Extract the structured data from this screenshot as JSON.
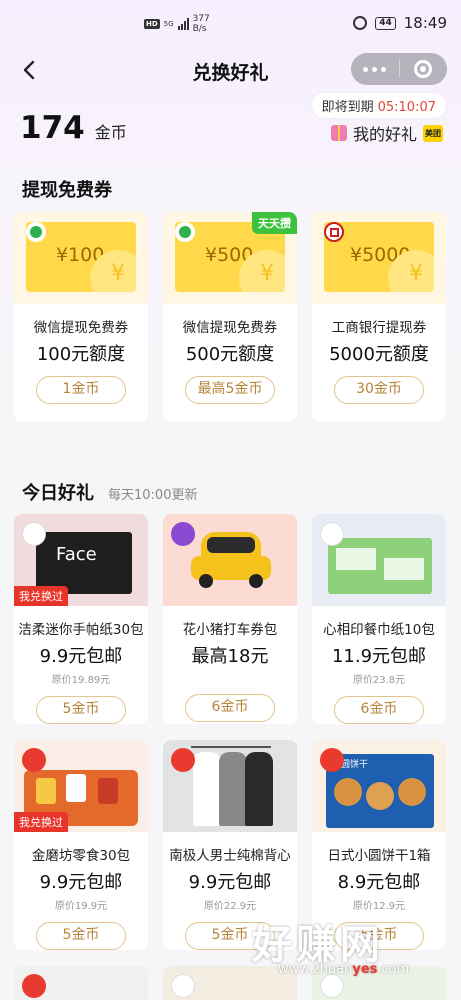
{
  "status_bar": {
    "net_speed_value": "377",
    "net_speed_unit": "B/s",
    "battery": "44",
    "time": "18:49",
    "signal": "5G"
  },
  "nav": {
    "title": "兑换好礼"
  },
  "account": {
    "coins": "174",
    "coins_unit": "金币",
    "expire_label": "即将到期",
    "expire_timer": "05:10:07",
    "my_gifts_label": "我的好礼",
    "meituan_badge": "美团"
  },
  "section_withdraw": {
    "title": "提现免费券",
    "items": [
      {
        "name": "微信提现免费券",
        "value": "100元额度",
        "ticket": "¥100",
        "button": "1金币",
        "icon": "wechat-icon"
      },
      {
        "name": "微信提现免费券",
        "value": "500元额度",
        "ticket": "¥500",
        "button": "最高5金币",
        "tag": "天天攒",
        "icon": "wechat-icon"
      },
      {
        "name": "工商银行提现券",
        "value": "5000元额度",
        "ticket": "¥5000",
        "button": "30金币",
        "icon": "icbc-icon"
      }
    ]
  },
  "section_daily": {
    "title": "今日好礼",
    "subtitle": "每天10:00更新",
    "items": [
      {
        "name": "洁柔迷你手帕纸30包",
        "price": "9.9元包邮",
        "orig": "原价19.89元",
        "button": "5金币",
        "tag": "我兑换过",
        "product_text": "Face"
      },
      {
        "name": "花小猪打车券包",
        "price": "最高18元",
        "button": "6金币"
      },
      {
        "name": "心相印餐巾纸10包",
        "price": "11.9元包邮",
        "orig": "原价23.8元",
        "button": "6金币"
      },
      {
        "name": "金磨坊零食30包",
        "price": "9.9元包邮",
        "orig": "原价19.9元",
        "button": "5金币",
        "tag": "我兑换过"
      },
      {
        "name": "南极人男士纯棉背心",
        "price": "9.9元包邮",
        "orig": "原价22.9元",
        "button": "5金币"
      },
      {
        "name": "日式小圆饼干1箱",
        "price": "8.9元包邮",
        "orig": "原价12.9元",
        "button": "5金币",
        "product_text": "小圆饼干"
      }
    ]
  },
  "watermark": {
    "text": "好赚网",
    "url_a": "www.zhuan",
    "url_b": "yes",
    "url_c": ".com"
  }
}
